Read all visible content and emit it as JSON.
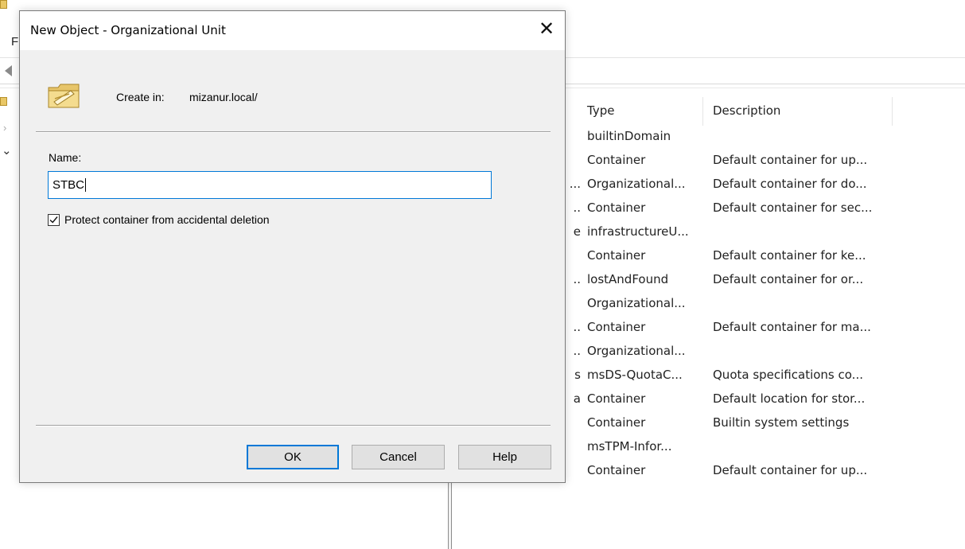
{
  "background_window": {
    "menu_first_letter": "F",
    "list": {
      "columns": {
        "type": "Type",
        "description": "Description"
      },
      "rows": [
        {
          "name_tail": "",
          "type": "builtinDomain",
          "description": ""
        },
        {
          "name_tail": "",
          "type": "Container",
          "description": "Default container for up..."
        },
        {
          "name_tail": "...",
          "type": "Organizational...",
          "description": "Default container for do..."
        },
        {
          "name_tail": "..",
          "type": "Container",
          "description": "Default container for sec..."
        },
        {
          "name_tail": "e",
          "type": "infrastructureU...",
          "description": ""
        },
        {
          "name_tail": "",
          "type": "Container",
          "description": "Default container for ke..."
        },
        {
          "name_tail": "..",
          "type": "lostAndFound",
          "description": "Default container for or..."
        },
        {
          "name_tail": "",
          "type": "Organizational...",
          "description": ""
        },
        {
          "name_tail": "..",
          "type": "Container",
          "description": "Default container for ma..."
        },
        {
          "name_tail": "..",
          "type": "Organizational...",
          "description": ""
        },
        {
          "name_tail": "s",
          "type": "msDS-QuotaC...",
          "description": "Quota specifications co..."
        },
        {
          "name_tail": "a",
          "type": "Container",
          "description": "Default location for stor..."
        },
        {
          "name_tail": "",
          "type": "Container",
          "description": "Builtin system settings"
        },
        {
          "name_tail": "",
          "type": "msTPM-Infor...",
          "description": ""
        },
        {
          "name_tail": "",
          "type": "Container",
          "description": "Default container for up..."
        }
      ]
    }
  },
  "dialog": {
    "title": "New Object - Organizational Unit",
    "close_icon": "close-icon",
    "create_in_label": "Create in:",
    "create_in_value": "mizanur.local/",
    "name_label": "Name:",
    "name_value": "STBC",
    "protect_checkbox": {
      "label": "Protect container from accidental deletion",
      "checked": true
    },
    "buttons": {
      "ok": "OK",
      "cancel": "Cancel",
      "help": "Help"
    },
    "accent_color": "#0078d7"
  }
}
